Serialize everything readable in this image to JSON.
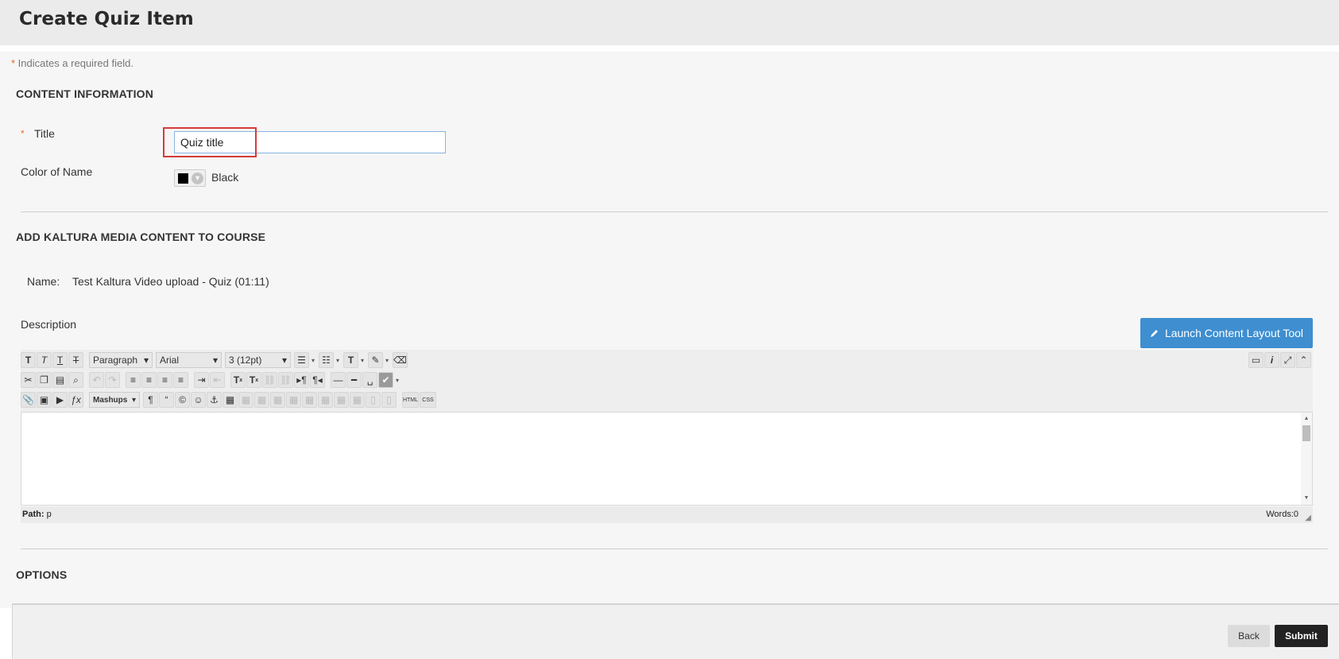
{
  "page": {
    "title": "Create Quiz Item"
  },
  "required_note": {
    "star": "*",
    "text": " Indicates a required field."
  },
  "content_info": {
    "heading": "CONTENT INFORMATION",
    "title_label": "Title",
    "title_star": "*",
    "title_value": "Quiz title",
    "color_label": "Color of Name",
    "color_value": "Black",
    "color_hex": "#000000"
  },
  "kaltura": {
    "heading": "ADD KALTURA MEDIA CONTENT TO COURSE",
    "name_label": "Name:",
    "name_value": "Test Kaltura Video upload - Quiz (01:11)"
  },
  "description": {
    "label": "Description",
    "launch_button": "Launch Content Layout Tool",
    "format_select": "Paragraph",
    "font_select": "Arial",
    "size_select": "3 (12pt)",
    "mashups_label": "Mashups",
    "html_label": "HTML",
    "css_label": "CSS",
    "path_label": "Path:",
    "path_value": "p",
    "words_label": "Words:",
    "words_value": "0"
  },
  "options": {
    "heading": "OPTIONS"
  },
  "footer": {
    "back_label": "Back",
    "submit_label": "Submit"
  },
  "colors": {
    "accent": "#3e8ed0",
    "highlight": "#d63b3b",
    "required": "#e26a2c"
  }
}
